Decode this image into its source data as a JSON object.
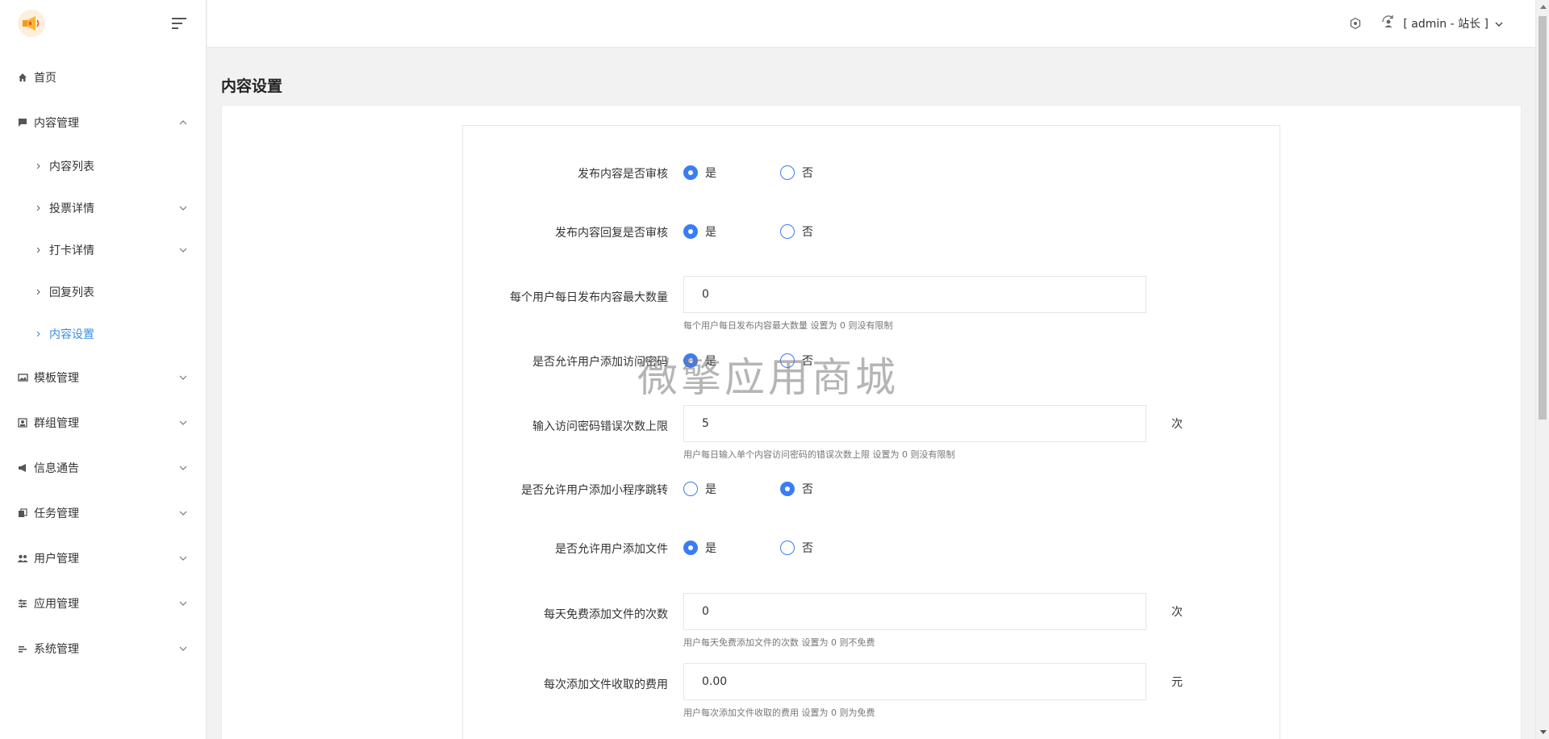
{
  "header": {
    "user_label": "[ admin - 站长 ]",
    "icons": [
      "settings-hex-icon",
      "user-refresh-icon",
      "chevron-down-icon"
    ]
  },
  "sidebar": {
    "items": [
      {
        "label": "首页",
        "icon": "home-icon"
      },
      {
        "label": "内容管理",
        "icon": "message-icon",
        "expanded": true
      },
      {
        "label": "模板管理",
        "icon": "template-icon"
      },
      {
        "label": "群组管理",
        "icon": "group-icon"
      },
      {
        "label": "信息通告",
        "icon": "megaphone-icon"
      },
      {
        "label": "任务管理",
        "icon": "task-icon"
      },
      {
        "label": "用户管理",
        "icon": "users-icon"
      },
      {
        "label": "应用管理",
        "icon": "app-icon"
      },
      {
        "label": "系统管理",
        "icon": "system-icon"
      }
    ],
    "sub_items": [
      {
        "label": "内容列表"
      },
      {
        "label": "投票详情"
      },
      {
        "label": "打卡详情"
      },
      {
        "label": "回复列表"
      },
      {
        "label": "内容设置",
        "active": true
      }
    ]
  },
  "page": {
    "title": "内容设置"
  },
  "form": {
    "yes": "是",
    "no": "否",
    "fields": [
      {
        "label": "发布内容是否审核",
        "type": "radio",
        "value": "是"
      },
      {
        "label": "发布内容回复是否审核",
        "type": "radio",
        "value": "是"
      },
      {
        "label": "每个用户每日发布内容最大数量",
        "type": "input",
        "value": "0",
        "hint": "每个用户每日发布内容最大数量 设置为 0 则没有限制"
      },
      {
        "label": "是否允许用户添加访问密码",
        "type": "radio",
        "value": "是"
      },
      {
        "label": "输入访问密码错误次数上限",
        "type": "input",
        "value": "5",
        "unit": "次",
        "hint": "用户每日输入单个内容访问密码的错误次数上限 设置为 0 则没有限制"
      },
      {
        "label": "是否允许用户添加小程序跳转",
        "type": "radio",
        "value": "否"
      },
      {
        "label": "是否允许用户添加文件",
        "type": "radio",
        "value": "是"
      },
      {
        "label": "每天免费添加文件的次数",
        "type": "input",
        "value": "0",
        "unit": "次",
        "hint": "用户每天免费添加文件的次数 设置为 0 则不免费"
      },
      {
        "label": "每次添加文件收取的费用",
        "type": "input",
        "value": "0.00",
        "unit": "元",
        "hint": "用户每次添加文件收取的费用 设置为 0 则为免费"
      }
    ]
  },
  "watermark": "微擎应用商城",
  "colors": {
    "accent": "#3b7cf6",
    "active_menu": "#3a8ee6"
  }
}
